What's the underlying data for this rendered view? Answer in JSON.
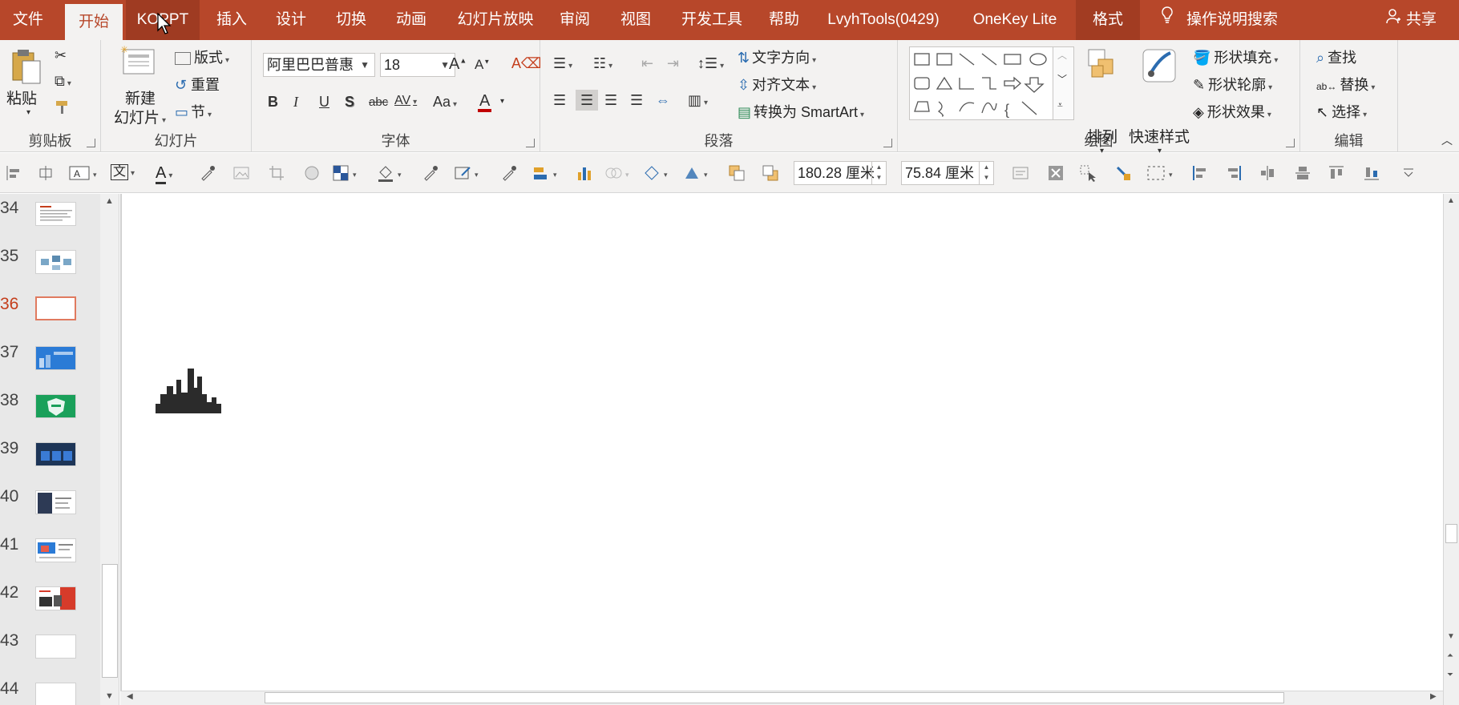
{
  "tabs": [
    "文件",
    "开始",
    "KOPPT",
    "插入",
    "设计",
    "切换",
    "动画",
    "幻灯片放映",
    "审阅",
    "视图",
    "开发工具",
    "帮助",
    "LvyhTools(0429)",
    "OneKey Lite",
    "格式"
  ],
  "search_tab": "操作说明搜索",
  "share": "共享",
  "ribbon": {
    "clipboard": {
      "label": "剪贴板",
      "paste": "粘贴"
    },
    "slides": {
      "label": "幻灯片",
      "new_slide": "新建",
      "new_slide2": "幻灯片",
      "layout": "版式",
      "reset": "重置",
      "section": "节"
    },
    "font": {
      "label": "字体",
      "font_name": "阿里巴巴普惠",
      "font_size": "18",
      "bold": "B",
      "italic": "I",
      "underline": "U",
      "shadow": "S",
      "strike": "abc",
      "spacing": "AV",
      "case": "Aa",
      "color": "A"
    },
    "paragraph": {
      "label": "段落",
      "text_direction": "文字方向",
      "align_text": "对齐文本",
      "smartart": "转换为 SmartArt"
    },
    "drawing": {
      "label": "绘图",
      "arrange": "排列",
      "quick_styles": "快速样式",
      "shape_fill": "形状填充",
      "shape_outline": "形状轮廓",
      "shape_effects": "形状效果"
    },
    "editing": {
      "label": "编辑",
      "find": "查找",
      "replace": "替换",
      "select": "选择"
    }
  },
  "quick_toolbar": {
    "width": "180.28 厘米",
    "height": "75.84 厘米",
    "text_style": "文"
  },
  "slides": [
    {
      "num": "34",
      "selected": false
    },
    {
      "num": "35",
      "selected": false
    },
    {
      "num": "36",
      "selected": true
    },
    {
      "num": "37",
      "selected": false
    },
    {
      "num": "38",
      "selected": false
    },
    {
      "num": "39",
      "selected": false
    },
    {
      "num": "40",
      "selected": false
    },
    {
      "num": "41",
      "selected": false
    },
    {
      "num": "42",
      "selected": false
    },
    {
      "num": "43",
      "selected": false
    },
    {
      "num": "44",
      "selected": false
    }
  ],
  "colors": {
    "accent": "#b7472a",
    "ribbon_bg": "#f3f2f1",
    "selected_slide": "#c43e1c"
  }
}
